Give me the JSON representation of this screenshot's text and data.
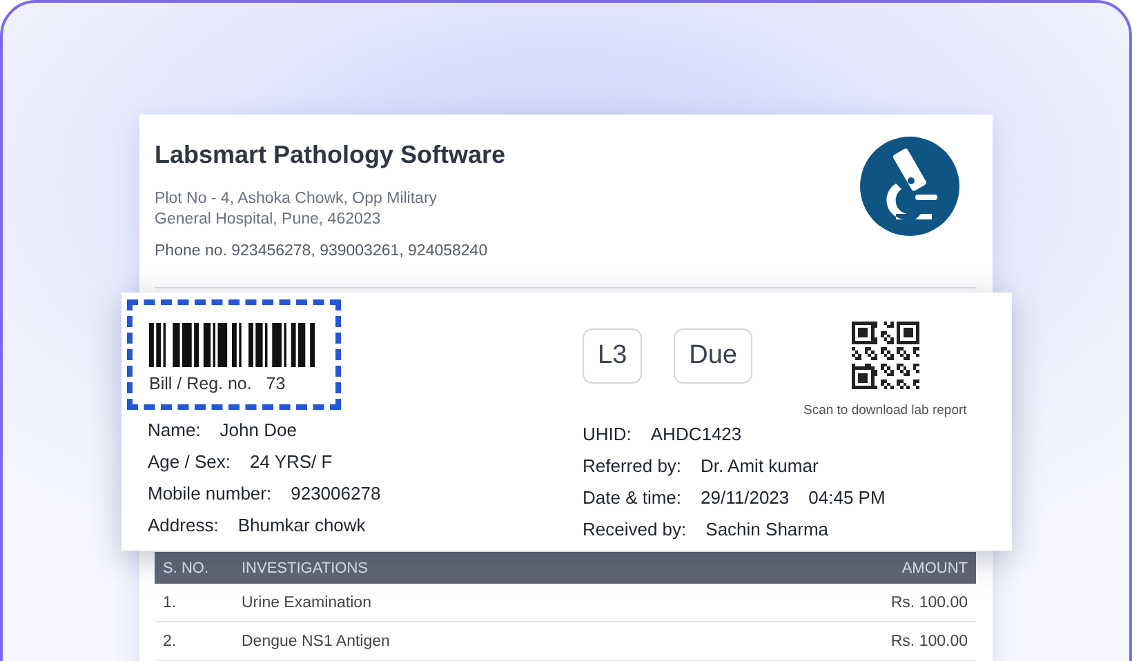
{
  "header": {
    "title": "Labsmart Pathology Software",
    "address_lines": [
      "Plot No - 4, Ashoka Chowk, Opp Military",
      "General Hospital, Pune, 462023"
    ],
    "phone": "Phone no. 923456278, 939003261, 924058240"
  },
  "bill": {
    "label": "Bill / Reg. no.",
    "number": "73"
  },
  "badges": [
    "L3",
    "Due"
  ],
  "qr_caption": "Scan to download lab report",
  "patient_details": [
    {
      "label": "Name:",
      "values": [
        "John Doe"
      ]
    },
    {
      "label": "Age / Sex:",
      "values": [
        "24 YRS/ F"
      ]
    },
    {
      "label": "Mobile number:",
      "values": [
        "923006278"
      ]
    },
    {
      "label": "Address:",
      "values": [
        "Bhumkar chowk"
      ]
    }
  ],
  "visit_details": [
    {
      "label": "UHID:",
      "values": [
        "AHDC1423"
      ]
    },
    {
      "label": "Referred by:",
      "values": [
        "Dr. Amit kumar"
      ]
    },
    {
      "label": "Date & time:",
      "values": [
        "29/11/2023",
        "04:45 PM"
      ]
    },
    {
      "label": "Received by:",
      "values": [
        "Sachin Sharma"
      ]
    }
  ],
  "table": {
    "columns": [
      "S. NO.",
      "INVESTIGATIONS",
      "AMOUNT"
    ],
    "rows": [
      [
        "1.",
        "Urine Examination",
        "Rs. 100.00"
      ],
      [
        "2.",
        "Dengue NS1 Antigen",
        "Rs. 100.00"
      ]
    ]
  }
}
